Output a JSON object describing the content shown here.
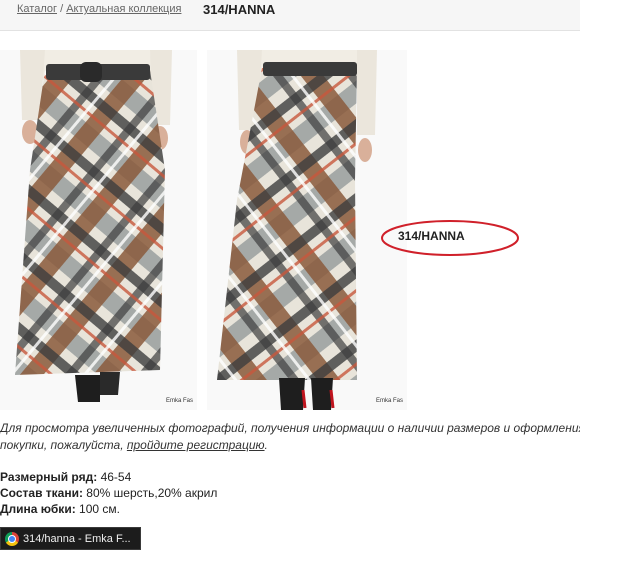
{
  "breadcrumb": {
    "items": [
      "Каталог",
      "Актуальная коллекция"
    ],
    "separator": "/"
  },
  "product": {
    "title": "314/HANNA",
    "sku_callout": "314/HANNA",
    "watermark": "Emka Fas",
    "specs": [
      {
        "label": "Размерный ряд:",
        "value": "46-54"
      },
      {
        "label": "Состав ткани:",
        "value": "80% шерсть,20% акрил"
      },
      {
        "label": "Длина юбки:",
        "value": "100 см."
      }
    ]
  },
  "notice": {
    "line1": "Для просмотра увеличенных фотографий, получения информации о наличии размеров и оформления",
    "line2_prefix": "покупки, пожалуйста, ",
    "link": "пройдите регистрацию",
    "line2_suffix": "."
  },
  "taskbar": {
    "label": "314/hanna - Emka F...",
    "icon": "chrome-icon"
  },
  "colors": {
    "callout_ellipse": "#d0202a",
    "plaid_brown": "#8a5a3c",
    "plaid_grey": "#9ea3a2",
    "plaid_dark": "#3d3d3d",
    "plaid_cream": "#e8e4da"
  }
}
